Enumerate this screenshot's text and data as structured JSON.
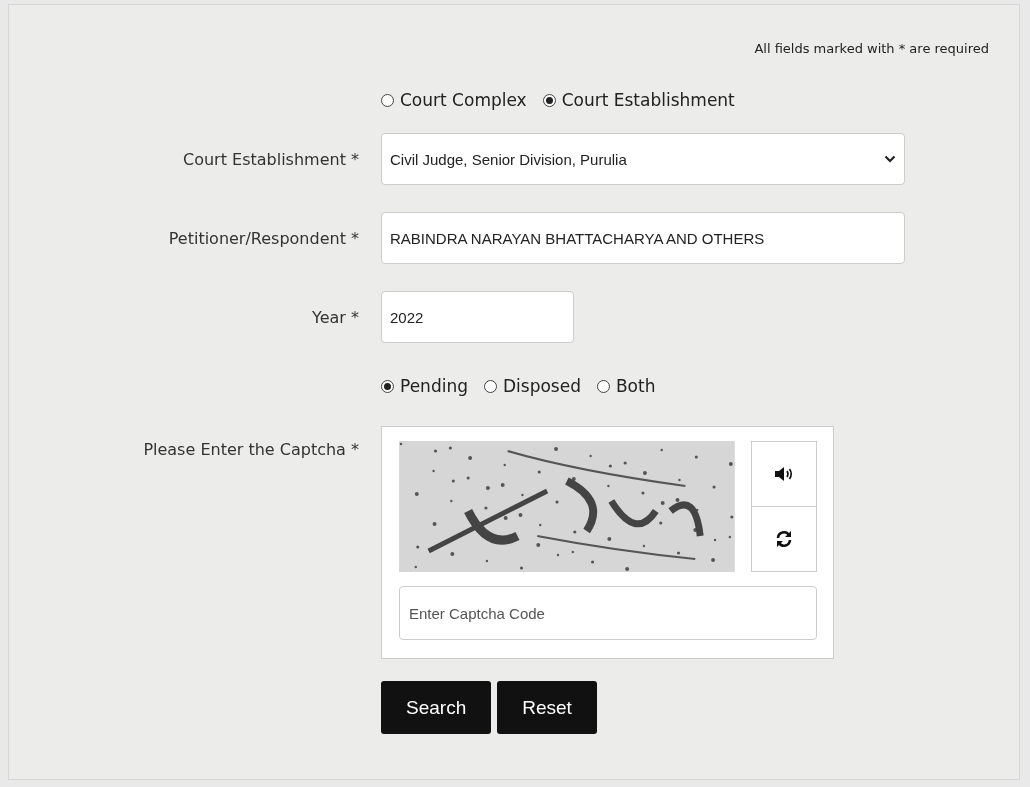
{
  "required_note": "All fields marked with * are required",
  "search_type": [
    {
      "label": "Court Complex",
      "selected": false
    },
    {
      "label": "Court Establishment",
      "selected": true
    }
  ],
  "court_establishment": {
    "label": "Court Establishment *",
    "value": "Civil Judge, Senior Division, Purulia"
  },
  "petitioner_respondent": {
    "label": "Petitioner/Respondent *",
    "value": "RABINDRA NARAYAN BHATTACHARYA  AND OTHERS"
  },
  "year": {
    "label": "Year *",
    "value": "2022"
  },
  "case_status": [
    {
      "label": "Pending",
      "selected": true
    },
    {
      "label": "Disposed",
      "selected": false
    },
    {
      "label": "Both",
      "selected": false
    }
  ],
  "captcha": {
    "label": "Please Enter the Captcha *",
    "placeholder": "Enter Captcha Code"
  },
  "buttons": [
    "Search",
    "Reset"
  ]
}
